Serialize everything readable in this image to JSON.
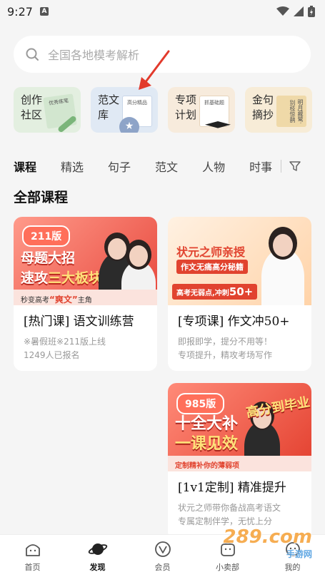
{
  "status_bar": {
    "time": "9:27",
    "sim_label": "A"
  },
  "search": {
    "placeholder": "全国各地模考解析"
  },
  "feature_cards": [
    {
      "line1": "创作",
      "line2": "社区",
      "tag": "优秀练笔"
    },
    {
      "line1": "范文",
      "line2": "库",
      "tag": "高分精品"
    },
    {
      "line1": "专项",
      "line2": "计划",
      "tag": "抓基础题"
    },
    {
      "line1": "金句",
      "line2": "摘抄",
      "tag": "明月藏鹭·别枝惊鹊"
    }
  ],
  "tabs": [
    "课程",
    "精选",
    "句子",
    "范文",
    "人物",
    "时事"
  ],
  "active_tab": "课程",
  "section_title": "全部课程",
  "courses": [
    {
      "banner": {
        "pill": "211版",
        "line1": "母题大招",
        "line2_a": "速攻",
        "line2_hl": "三大板块",
        "foot_a": "秒变高考",
        "foot_em": "“爽文”",
        "foot_b": "主角"
      },
      "title": "[热门课] 语文训练营",
      "desc1": "※暑假班※211版上线",
      "desc2": "1249人已报名"
    },
    {
      "banner": {
        "line1": "状元之师亲授",
        "line2": "作文无痛高分秘籍",
        "tag_a": "高考无弱点,冲刺",
        "tag_n": "50+"
      },
      "title": "[专项课] 作文冲50+",
      "desc1": "即报即学，提分不用等！",
      "desc2": "专项提升，精攻考场写作"
    },
    {
      "banner": {
        "pill": "985版",
        "line1": "十全大补",
        "line2": "一课见效",
        "stamp": "高分到毕业",
        "foot": "定制精补你的薄弱项"
      },
      "title": "[1v1定制] 精准提升",
      "desc1": "状元之师带你备战高考语文",
      "desc2": "专属定制伴学，无忧上分"
    }
  ],
  "watermark": {
    "main": "289.com",
    "sub": "手游网"
  },
  "bottom_nav": [
    {
      "label": "首页",
      "icon": "home-icon"
    },
    {
      "label": "发现",
      "icon": "planet-icon"
    },
    {
      "label": "会员",
      "icon": "vip-icon"
    },
    {
      "label": "小卖部",
      "icon": "shop-icon"
    },
    {
      "label": "我的",
      "icon": "profile-icon"
    }
  ],
  "colors": {
    "accent": "#e1432f",
    "background": "#f5f5f5"
  }
}
